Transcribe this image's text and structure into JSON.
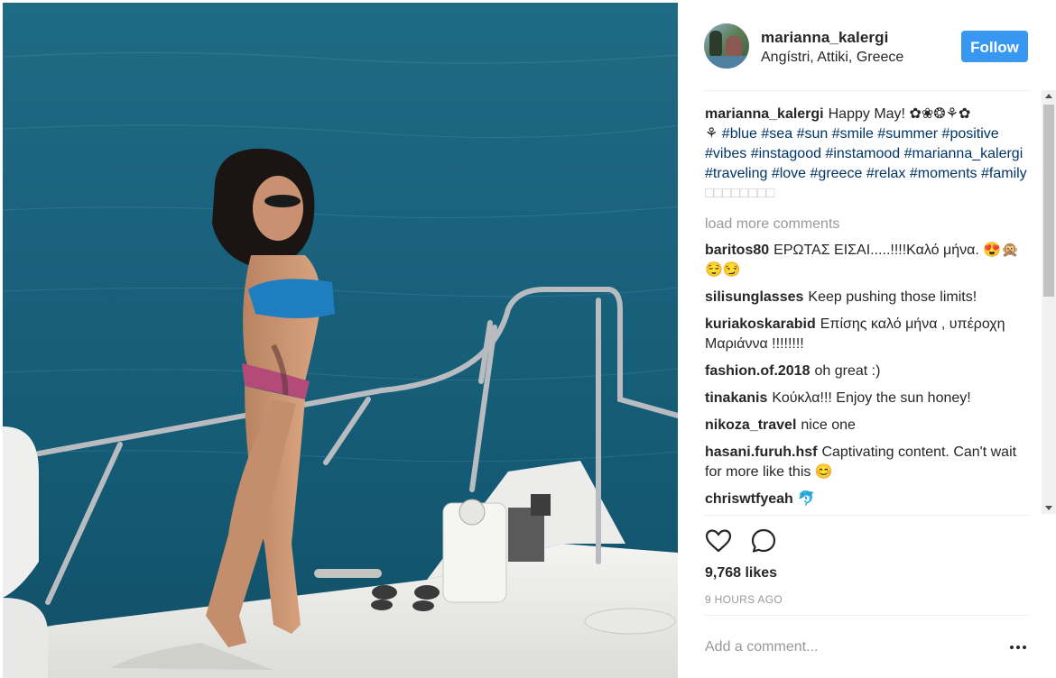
{
  "post": {
    "user": {
      "username": "marianna_kalergi",
      "location": "Angístri, Attiki, Greece",
      "follow_label": "Follow"
    },
    "caption": {
      "username": "marianna_kalergi",
      "text_start": "Happy May! ✿❀❂⚘✿",
      "text_line2_prefix": "⚘",
      "hashtags": [
        "#blue",
        "#sea",
        "#sun",
        "#smile",
        "#summer",
        "#positive",
        "#vibes",
        "#instagood",
        "#instamood",
        "#marianna_kalergi",
        "#traveling",
        "#love",
        "#greece",
        "#relax",
        "#moments",
        "#family"
      ],
      "trailing": "□□□□□□□□"
    },
    "load_more_label": "load more comments",
    "comments": [
      {
        "user": "baritos80",
        "text": "ΕΡΩΤΑΣ ΕΙΣΑΙ.....!!!!Καλό μήνα. 😍🙊😌😏"
      },
      {
        "user": "silisunglasses",
        "text": "Keep pushing those limits!"
      },
      {
        "user": "kuriakoskarabid",
        "text": "Επίσης καλό μήνα , υπέροχη Μαριάννα !!!!!!!!"
      },
      {
        "user": "fashion.of.2018",
        "text": "oh great :)"
      },
      {
        "user": "tinakanis",
        "text": "Κούκλα!!! Enjoy the sun honey!"
      },
      {
        "user": "nikoza_travel",
        "text": "nice one"
      },
      {
        "user": "hasani.furuh.hsf",
        "text": "Captivating content. Can't wait for more like this 😊"
      },
      {
        "user": "chriswtfyeah",
        "text": "🐬"
      }
    ],
    "likes": "9,768 likes",
    "time": "9 HOURS AGO",
    "add_comment_placeholder": "Add a comment...",
    "icons": {
      "like": "heart-icon",
      "comment": "comment-bubble-icon",
      "more": "more-options-icon"
    },
    "colors": {
      "follow_bg": "#3897f0",
      "hashtag": "#003569",
      "muted": "#999999"
    }
  }
}
